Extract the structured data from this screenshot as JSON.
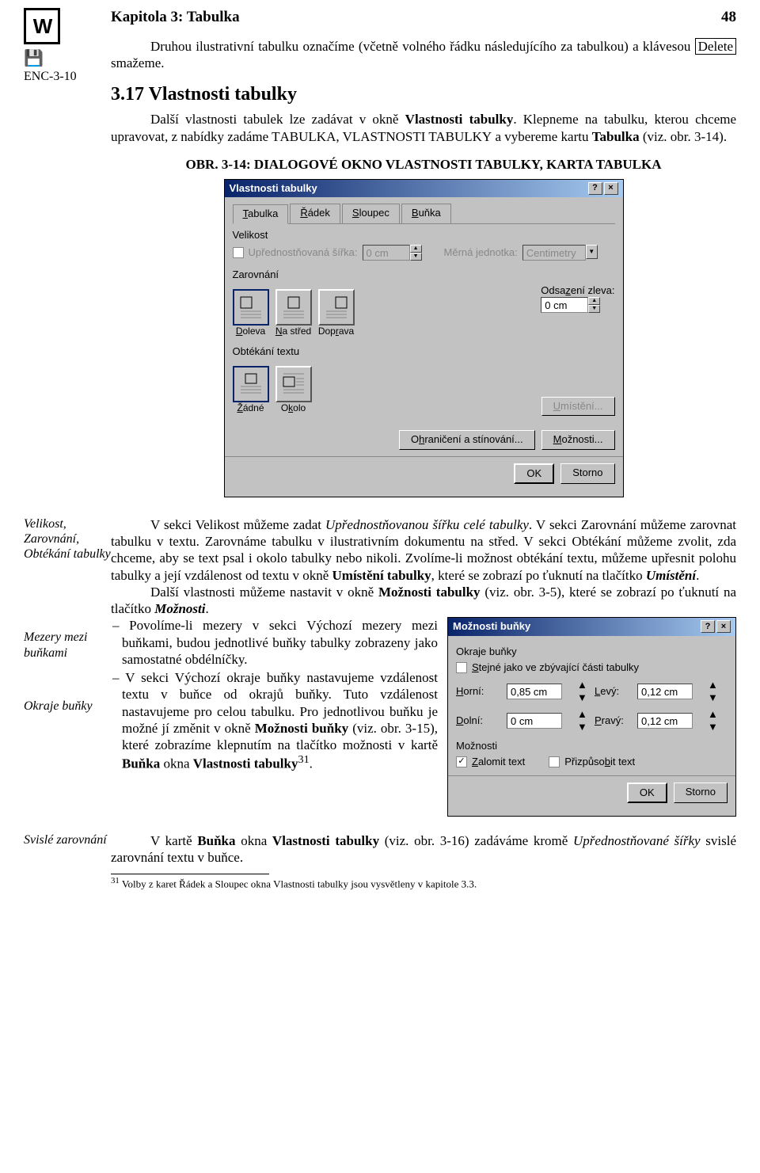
{
  "header": {
    "chapter": "Kapitola 3: Tabulka",
    "page": "48"
  },
  "left": {
    "enc": "ENC-3-10",
    "icon_letter": "W"
  },
  "p1a": "Druhou ilustrativní tabulku označíme (včetně volného řádku následujícího za tabulkou) a klávesou ",
  "p1key": "Delete",
  "p1b": " smažeme.",
  "sec": "3.17 Vlastnosti tabulky",
  "p2a": "Další vlastnosti tabulek lze zadávat v okně ",
  "p2b": "Vlastnosti tabulky",
  "p2c": ". Klepneme na tabulku, kterou chceme upravovat, z nabídky zadáme T",
  "p2d": "ABULKA",
  "p2e": ", V",
  "p2f": "LASTNOSTI TABULKY",
  "p2g": " a vybereme kartu ",
  "p2h": "Tabulka",
  "p2i": " (viz. obr. 3-14).",
  "figcap": "OBR. 3-14: DIALOGOVÉ OKNO VLASTNOSTI TABULKY, KARTA TABULKA",
  "dlg1": {
    "title": "Vlastnosti tabulky",
    "tabs": [
      "Tabulka",
      "Řádek",
      "Sloupec",
      "Buňka"
    ],
    "grp_size": "Velikost",
    "chk_pref": "Upřednostňovaná šířka:",
    "pref_val": "0 cm",
    "unit_lbl": "Měrná jednotka:",
    "unit_val": "Centimetry",
    "grp_align": "Zarovnání",
    "opts_align": [
      "Doleva",
      "Na střed",
      "Doprava"
    ],
    "indent_lbl": "Odsazení zleva:",
    "indent_val": "0 cm",
    "grp_wrap": "Obtékání textu",
    "opts_wrap": [
      "Žádné",
      "Okolo"
    ],
    "btn_pos": "Umístění...",
    "btn_border": "Ohraničení a stínování...",
    "btn_opts": "Možnosti...",
    "btn_ok": "OK",
    "btn_cancel": "Storno"
  },
  "notes": {
    "n1": "Velikost, Zarovnání, Obtékání tabulky",
    "n2": "Mezery mezi buňkami",
    "n3": "Okraje buňky",
    "n4": "Svislé zarovnání"
  },
  "p3a": "V sekci Velikost můžeme zadat ",
  "p3b": "Upřednostňovanou šířku celé tabulky",
  "p3c": ". V sekci Zarovnání můžeme zarovnat tabulku v textu. Zarovnáme tabulku v ilustrativním dokumentu na střed. V sekci Obtékání můžeme zvolit, zda chceme, aby se text psal i okolo tabulky nebo nikoli. Zvolíme-li možnost obtékání textu, můžeme upřesnit polohu tabulky a její vzdálenost od textu v okně ",
  "p3d": "Umístění tabulky",
  "p3e": ", které se zobrazí po ťuknutí na tlačítko ",
  "p3f": "Umístění",
  "p3g": ".",
  "p4a": "Další vlastnosti můžeme nastavit v okně ",
  "p4b": "Možnosti tabulky",
  "p4c": " (viz. obr. 3-5), které se zobrazí po ťuknutí na tlačítko ",
  "p4d": "Možnosti",
  "p4e": ".",
  "b1a": "Povolíme-li mezery v sekci Výchozí mezery mezi buňkami, budou jednotlivé buňky tabulky zobrazeny jako samostatné obdélníčky.",
  "b2a": "V sekci Výchozí okraje buňky nastavujeme vzdálenost textu v buňce od okrajů buňky. Tuto vzdálenost nastavujeme pro celou tabulku. Pro jednotlivou buňku je možné jí změnit v okně ",
  "b2b": "Možnosti buňky",
  "b2c": " (viz. obr. 3-15), které zobrazíme klepnutím na tlačítko možnosti v kartě ",
  "b2d": "Buňka",
  "b2e": " okna ",
  "b2f": "Vlastnosti tabulky",
  "b2g": "31",
  "b2h": ".",
  "dlg2": {
    "title": "Možnosti buňky",
    "grp1": "Okraje buňky",
    "chk_same": "Stejné jako ve zbývající části tabulky",
    "rows": [
      {
        "l1": "Horní:",
        "v1": "0,85 cm",
        "l2": "Levý:",
        "v2": "0,12 cm"
      },
      {
        "l1": "Dolní:",
        "v1": "0 cm",
        "l2": "Pravý:",
        "v2": "0,12 cm"
      }
    ],
    "grp2": "Možnosti",
    "chk_wrap": "Zalomit text",
    "chk_fit": "Přizpůsobit text",
    "btn_ok": "OK",
    "btn_cancel": "Storno"
  },
  "p5a": "V kartě ",
  "p5b": "Buňka",
  "p5c": " okna ",
  "p5d": "Vlastnosti tabulky",
  "p5e": " (viz. obr. 3-16) zadáváme kromě ",
  "p5f": "Upřednostňované šířky",
  "p5g": " svislé zarovnání textu v buňce.",
  "fn_num": "31",
  "fn_txt": " Volby z karet Řádek a Sloupec okna Vlastnosti tabulky jsou vysvětleny v kapitole 3.3."
}
